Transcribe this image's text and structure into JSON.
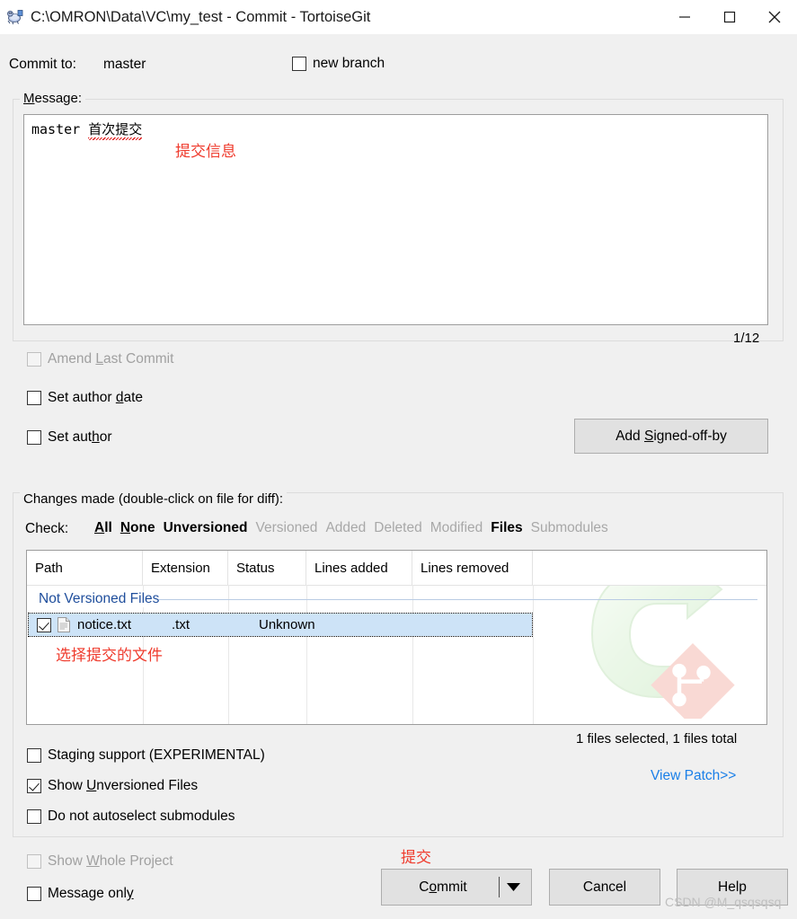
{
  "window": {
    "title": "C:\\OMRON\\Data\\VC\\my_test - Commit - TortoiseGit",
    "icon": "tortoisegit-icon",
    "minimize_label": "minimize-icon",
    "maximize_label": "maximize-icon",
    "close_label": "close-icon"
  },
  "commit_to": {
    "label": "Commit to:",
    "branch": "master",
    "new_branch_label": "new branch",
    "new_branch_checked": false
  },
  "message_group": {
    "legend_pre": "M",
    "legend_post": "essage:",
    "text_plain": "master ",
    "text_spelled": "首次提交",
    "annotation": "提交信息",
    "counter": "1/12"
  },
  "options": {
    "amend": {
      "label_pre": "Amend ",
      "label_key": "L",
      "label_post": "ast Commit",
      "checked": false,
      "disabled": true
    },
    "set_author_date": {
      "label_pre": "Set author ",
      "label_key": "d",
      "label_post": "ate",
      "checked": false,
      "disabled": false
    },
    "set_author": {
      "label_pre": "Set aut",
      "label_key": "h",
      "label_post": "or",
      "checked": false,
      "disabled": false
    },
    "signed_off_pre": "Add ",
    "signed_off_key": "S",
    "signed_off_post": "igned-off-by"
  },
  "changes": {
    "legend": "Changes made (double-click on file for diff):",
    "check_label": "Check:",
    "check_links": [
      {
        "label_pre": "A",
        "label_key": "ll",
        "text": "All",
        "enabled": true,
        "accel_first": true
      },
      {
        "text": "None",
        "enabled": true
      },
      {
        "text": "Unversioned",
        "enabled": true
      },
      {
        "text": "Versioned",
        "enabled": false
      },
      {
        "text": "Added",
        "enabled": false
      },
      {
        "text": "Deleted",
        "enabled": false
      },
      {
        "text": "Modified",
        "enabled": false
      },
      {
        "text": "Files",
        "enabled": true
      },
      {
        "text": "Submodules",
        "enabled": false
      }
    ],
    "columns": [
      "Path",
      "Extension",
      "Status",
      "Lines added",
      "Lines removed"
    ],
    "group_header": "Not Versioned Files",
    "rows": [
      {
        "checked": true,
        "icon": "text-file-icon",
        "path": "notice.txt",
        "extension": ".txt",
        "status": "Unknown",
        "lines_added": "",
        "lines_removed": "",
        "selected": true
      }
    ],
    "row_annotation": "选择提交的文件",
    "summary": "1 files selected, 1 files total",
    "view_patch": "View Patch>>"
  },
  "bottom_options": {
    "staging": {
      "label": "Staging support (EXPERIMENTAL)",
      "checked": false,
      "disabled": false
    },
    "show_unversioned": {
      "label_pre": "Show ",
      "label_key": "U",
      "label_post": "nversioned Files",
      "checked": true,
      "disabled": false
    },
    "no_autoselect": {
      "label": "Do not autoselect submodules",
      "checked": false,
      "disabled": false
    },
    "show_whole_project": {
      "label_pre": "Show ",
      "label_key": "W",
      "label_post": "hole Project",
      "checked": false,
      "disabled": true
    },
    "message_only": {
      "label_pre": "Message onl",
      "label_key": "y",
      "label_post": "",
      "checked": false,
      "disabled": false
    }
  },
  "buttons": {
    "commit_pre": "C",
    "commit_key": "o",
    "commit_post": "mmit",
    "commit_dropdown": "chevron-down-icon",
    "cancel": "Cancel",
    "help": "Help",
    "commit_annotation": "提交"
  },
  "watermark": {
    "logo": "tortoisegit-logo-watermark",
    "credit": "CSDN @M_qsqsqsq"
  },
  "colors": {
    "background": "#f0f0f0",
    "titlebar": "#ffffff",
    "annotation_red": "#ef3b2d",
    "link_blue": "#1a7fe8",
    "group_header_blue": "#1f4e9c",
    "row_selected": "#cde3f7",
    "button_face": "#e1e1e1"
  }
}
